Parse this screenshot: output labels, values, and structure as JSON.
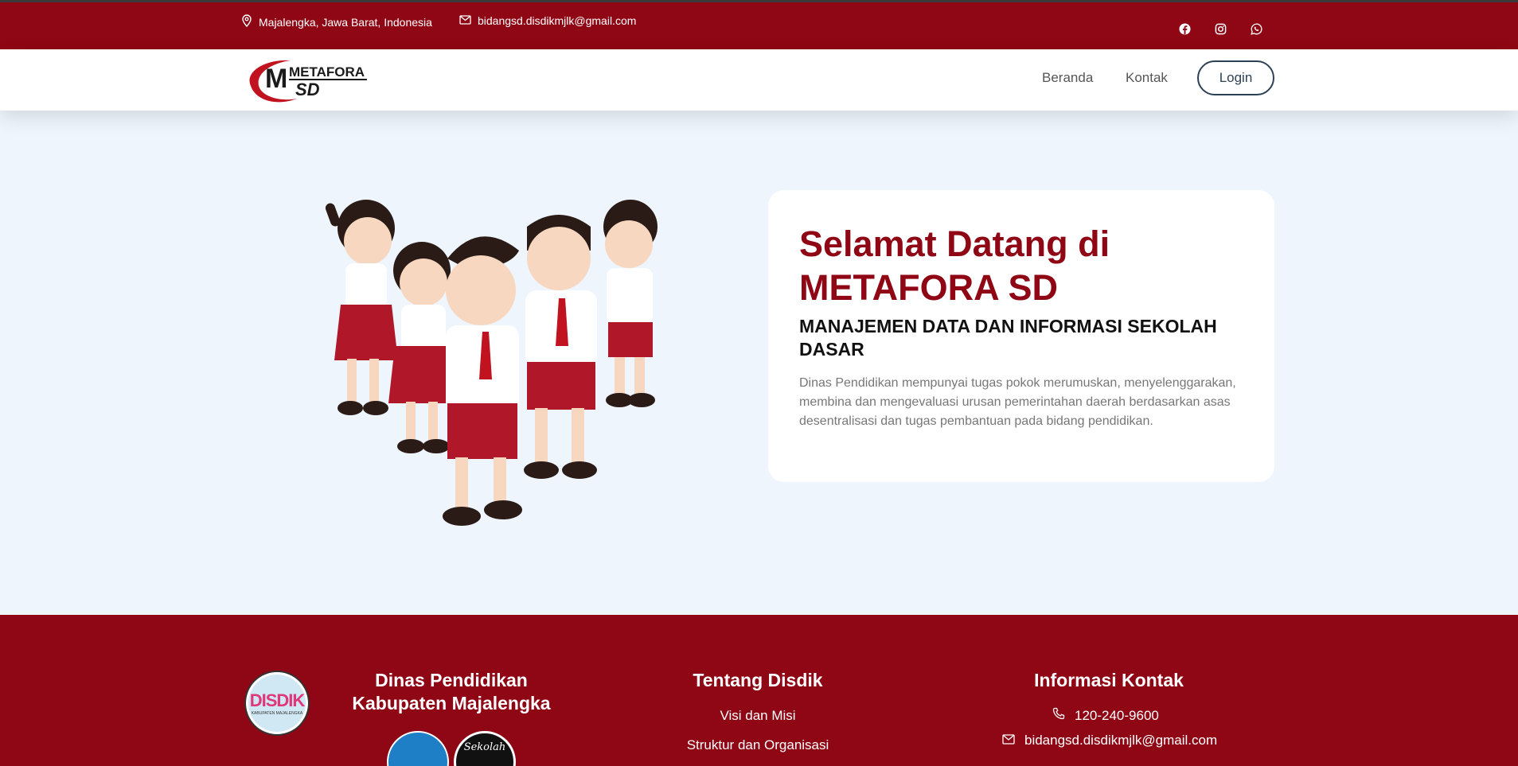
{
  "topbar": {
    "location": "Majalengka, Jawa Barat, Indonesia",
    "email": "bidangsd.disdikmjlk@gmail.com",
    "social": [
      "facebook-icon",
      "instagram-icon",
      "whatsapp-icon"
    ]
  },
  "navbar": {
    "logo_text": "METAFORA",
    "logo_sub": "SD",
    "links": [
      "Beranda",
      "Kontak"
    ],
    "login_label": "Login"
  },
  "hero": {
    "title": "Selamat Datang di METAFORA SD",
    "subtitle": "MANAJEMEN DATA DAN INFORMASI SEKOLAH DASAR",
    "description": "Dinas Pendidikan mempunyai tugas pokok merumuskan, menyelenggarakan, membina dan mengevaluasi urusan pemerintahan daerah berdasarkan asas desentralisasi dan tugas pembantuan pada bidang pendidikan."
  },
  "footer": {
    "col1_title": "Dinas Pendidikan Kabupaten Majalengka",
    "col1_logo_text": "DISDIK",
    "col1_logo_sub": "KABUPATEN MAJALENGKA",
    "col1_badge2_text": "Sekolah",
    "col2_title": "Tentang Disdik",
    "col2_links": [
      "Visi dan Misi",
      "Struktur dan Organisasi"
    ],
    "col3_title": "Informasi Kontak",
    "phone": "120-240-9600",
    "email": "bidangsd.disdikmjlk@gmail.com"
  },
  "colors": {
    "brand": "#8f0614",
    "hero_bg": "#eef5fd",
    "login_border": "#2d4156"
  }
}
